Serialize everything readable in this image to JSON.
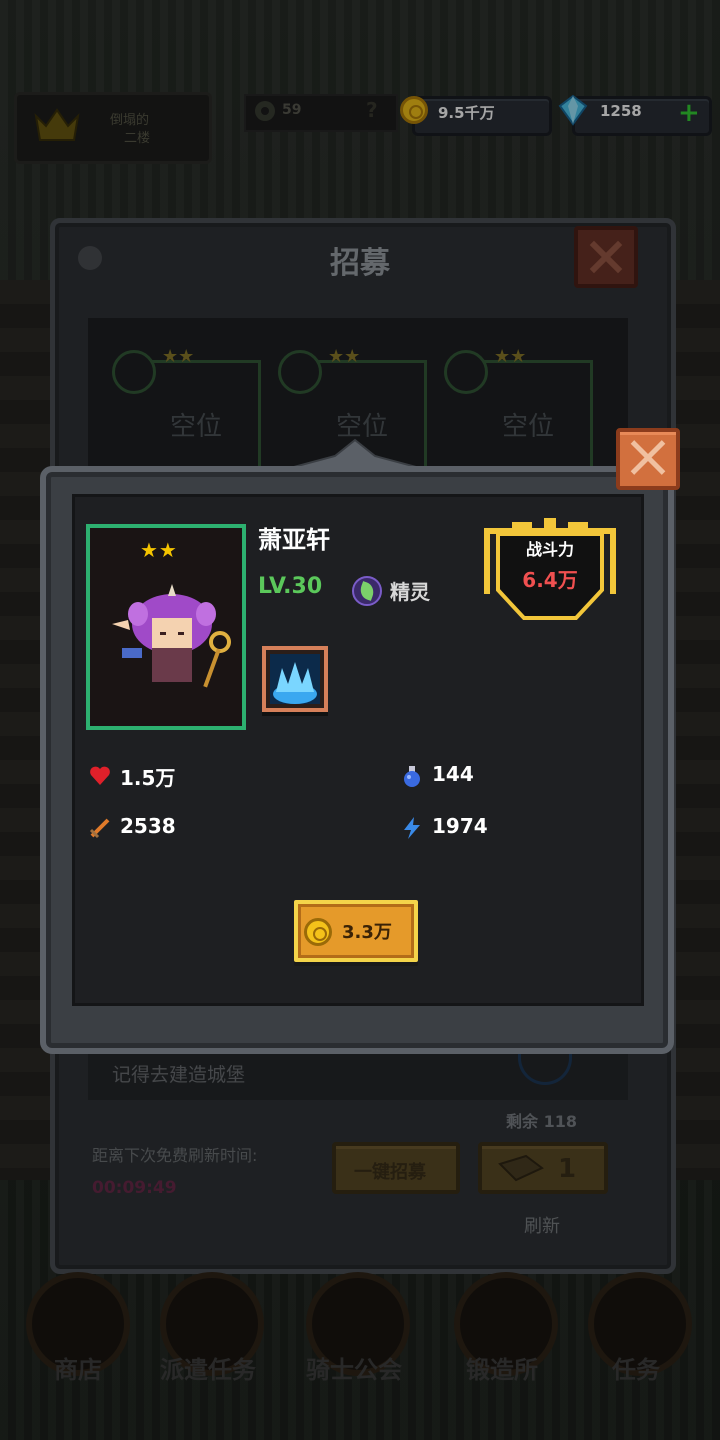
{
  "top_bar": {
    "crown_text_line1": "倒塌的",
    "crown_text_line2": "二楼",
    "gear_count": "59",
    "gear_hint": "?",
    "gold": "9.5千万",
    "gems": "1258",
    "add_label": "+"
  },
  "recruit_panel": {
    "title": "招募",
    "slots": [
      {
        "stars": "★★",
        "label": "空位"
      },
      {
        "stars": "★★",
        "label": "空位"
      },
      {
        "stars": "★★",
        "label": "空位"
      }
    ],
    "tip": "记得去建造城堡",
    "remaining": "剩余 118",
    "refresh_label": "距离下次免费刷新时间:",
    "timer": "00:09:49",
    "one_click_label": "一键招募",
    "refresh_count": "1",
    "refresh_word": "刷新"
  },
  "bottom_nav": [
    {
      "label": "商店"
    },
    {
      "label": "派遣任务"
    },
    {
      "label": "骑士公会"
    },
    {
      "label": "锻造所"
    },
    {
      "label": "任务"
    }
  ],
  "hero_card": {
    "stars": "★★",
    "name": "萧亚轩",
    "level": "LV.30",
    "race": "精灵",
    "power_label": "战斗力",
    "power_value": "6.4万",
    "hp": "1.5万",
    "mana": "144",
    "attack": "2538",
    "speed": "1974",
    "price": "3.3万"
  },
  "colors": {
    "portrait_border": "#2db070",
    "level_green": "#5bc85b",
    "power_red": "#f05050",
    "buy_button": "#e59a2a",
    "close_button": "#d2703e"
  }
}
